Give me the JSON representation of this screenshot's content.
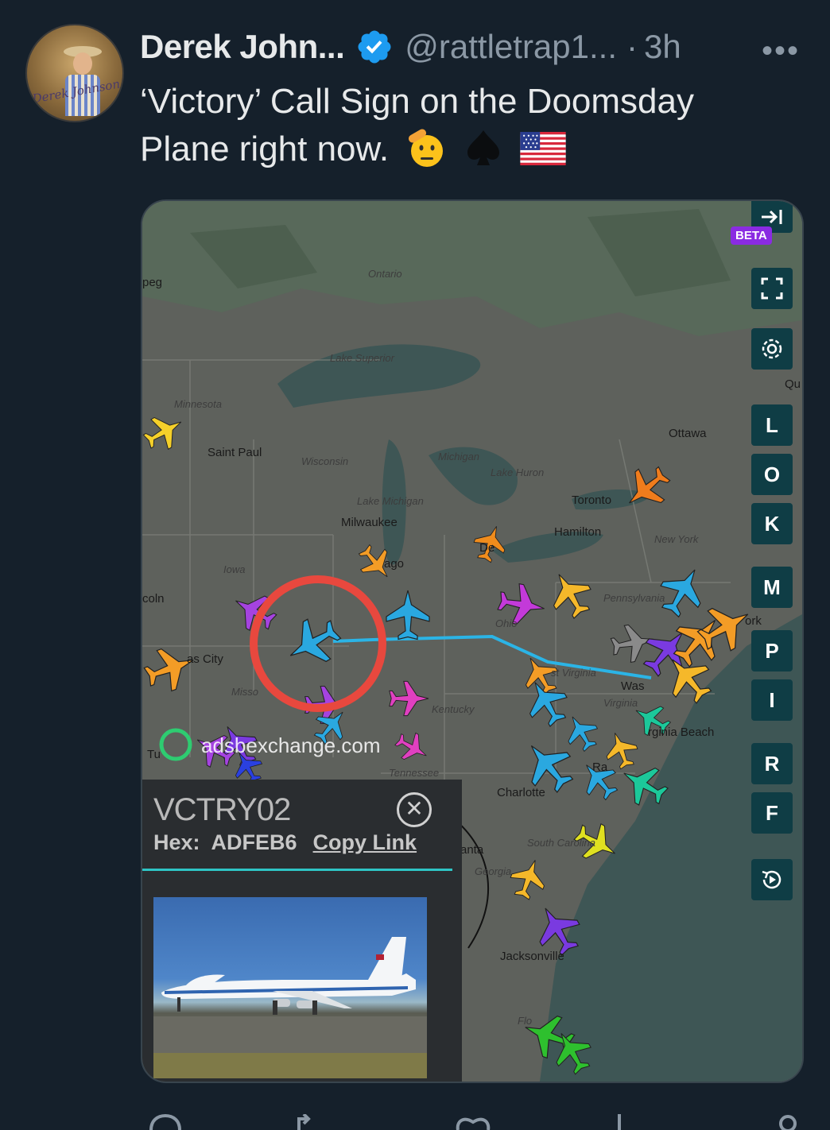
{
  "post": {
    "author_name": "Derek John...",
    "handle": "@rattletrap1...",
    "separator": "·",
    "time": "3h",
    "more": "•••",
    "text_line1": "‘Victory’ Call Sign on the Doomsday",
    "text_line2": "Plane right now.",
    "avatar_signature": "Derek Johnson"
  },
  "map": {
    "beta_badge": "BETA",
    "controls": [
      "L",
      "O",
      "K",
      "M",
      "P",
      "I",
      "R",
      "F"
    ],
    "watermark": "adsbexchange.com",
    "labels": {
      "ontario": "Ontario",
      "lake_superior": "Lake Superior",
      "minnesota": "Minnesota",
      "saint_paul": "Saint Paul",
      "wisconsin": "Wisconsin",
      "michigan": "Michigan",
      "lake_huron": "Lake Huron",
      "lake_michigan": "Lake Michigan",
      "milwaukee": "Milwaukee",
      "toronto": "Toronto",
      "hamilton": "Hamilton",
      "ottawa": "Ottawa",
      "new_york": "New York",
      "pennsylvania": "Pennsylvania",
      "iowa": "Iowa",
      "ohio": "Ohio",
      "kentucky": "Kentucky",
      "tennessee": "Tennessee",
      "west_virginia": "st Virginia",
      "virginia": "Virginia",
      "virginia_beach": "rginia Beach",
      "charlotte": "Charlotte",
      "south_carolina": "South Carolina",
      "georgia": "Georgia",
      "jacksonville": "Jacksonville",
      "florida": "Flo",
      "kansas_city": "as City",
      "missouri": "Misso",
      "lincoln": "coln",
      "winnipeg": "peg",
      "chicago": "ago",
      "detroit": "De",
      "washington": "Was",
      "tulsa": "Tu",
      "quebec": "Qu",
      "york": "ork",
      "raleigh": "Ra",
      "atlanta": "anta"
    }
  },
  "info_panel": {
    "callsign": "VCTRY02",
    "hex_label": "Hex:",
    "hex_value": "ADFEB6",
    "copy_link": "Copy Link",
    "close_symbol": "✕"
  },
  "icons": {
    "verified": "verified-badge-icon",
    "emoji_salute": "saluting-face-emoji",
    "emoji_spade": "spade-suit-emoji",
    "emoji_flag": "us-flag-emoji"
  },
  "colors": {
    "background": "#15202b",
    "verified_blue": "#1d9bf0",
    "track_line": "#2bb4e6",
    "highlight_circle": "#e8483e",
    "plane_highlight": "#2aa8e0"
  }
}
